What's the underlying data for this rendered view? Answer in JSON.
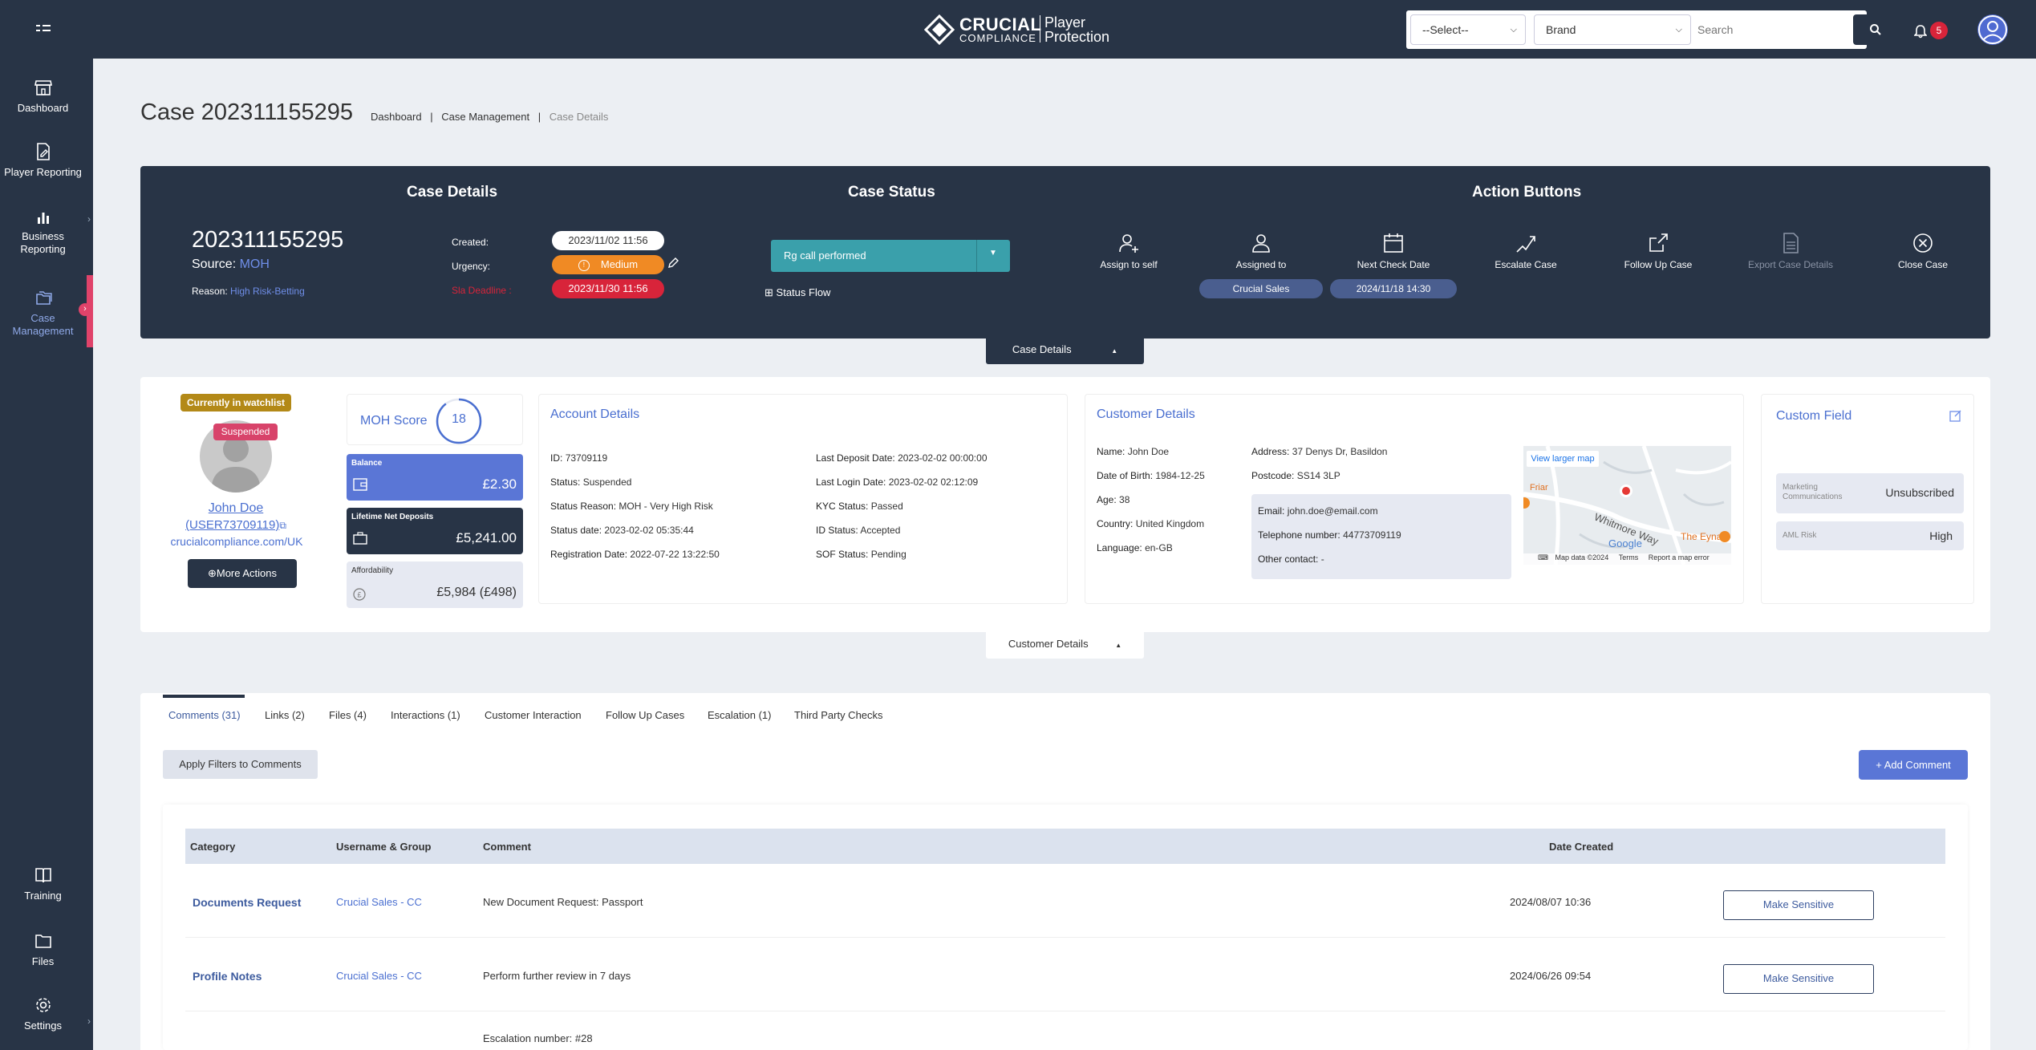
{
  "topbar": {
    "menu_icon": "grid-menu-icon",
    "logo_main": "CRUCIAL",
    "logo_sub": "COMPLIANCE",
    "logo_player": "Player",
    "logo_protection": "Protection",
    "select_value": "--Select--",
    "brand_value": "Brand",
    "search_placeholder": "Search",
    "notification_count": "5"
  },
  "sidebar": {
    "items": [
      {
        "label": "Dashboard",
        "icon": "store-icon"
      },
      {
        "label": "Player Reporting",
        "icon": "document-edit-icon"
      },
      {
        "label_1": "Business",
        "label_2": "Reporting",
        "icon": "bar-chart-icon"
      },
      {
        "label_1": "Case",
        "label_2": "Management",
        "icon": "folders-icon"
      },
      {
        "label": "Training",
        "icon": "book-icon"
      },
      {
        "label": "Files",
        "icon": "folder-icon"
      },
      {
        "label": "Settings",
        "icon": "gear-icon"
      }
    ]
  },
  "page": {
    "title": "Case 202311155295",
    "breadcrumb": [
      "Dashboard",
      "Case Management",
      "Case Details"
    ]
  },
  "case_panel": {
    "details_heading": "Case Details",
    "status_heading": "Case Status",
    "actions_heading": "Action Buttons",
    "case_number": "202311155295",
    "source_label": "Source:",
    "source_value": "MOH",
    "reason_label": "Reason:",
    "reason_value": "High Risk-Betting",
    "created_label": "Created:",
    "created_value": "2023/11/02 11:56",
    "urgency_label": "Urgency:",
    "urgency_value": "Medium",
    "sla_label": "Sla Deadline :",
    "sla_value": "2023/11/30 11:56",
    "status_value": "Rg call performed",
    "status_flow": "Status Flow",
    "actions": [
      {
        "label": "Assign to self",
        "icon": "user-add-icon"
      },
      {
        "label": "Assigned to",
        "icon": "user-icon",
        "badge": "Crucial Sales"
      },
      {
        "label": "Next Check Date",
        "icon": "calendar-icon",
        "badge": "2024/11/18 14:30"
      },
      {
        "label": "Escalate Case",
        "icon": "escalate-icon"
      },
      {
        "label": "Follow Up Case",
        "icon": "share-icon"
      },
      {
        "label": "Export Case Details",
        "icon": "export-document-icon"
      },
      {
        "label": "Close Case",
        "icon": "close-circle-icon"
      }
    ],
    "toggle_label": "Case Details"
  },
  "customer": {
    "watchlist_badge": "Currently in watchlist",
    "suspended_badge": "Suspended",
    "name": "John Doe",
    "user_id": "(USER73709119)",
    "site": "crucialcompliance.com/UK",
    "more_actions": "More Actions",
    "moh_score_label": "MOH Score",
    "moh_score": "18",
    "balance_label": "Balance",
    "balance_value": "£2.30",
    "lnd_label": "Lifetime Net Deposits",
    "lnd_value": "£5,241.00",
    "affordability_label": "Affordability",
    "affordability_value": "£5,984 (£498)"
  },
  "account_details": {
    "heading": "Account Details",
    "left": [
      {
        "k": "ID:",
        "v": "73709119"
      },
      {
        "k": "Status:",
        "v": "Suspended"
      },
      {
        "k": "Status Reason:",
        "v": "MOH - Very High Risk"
      },
      {
        "k": "Status date:",
        "v": "2023-02-02 05:35:44"
      },
      {
        "k": "Registration Date:",
        "v": "2022-07-22 13:22:50"
      }
    ],
    "right": [
      {
        "k": "Last Deposit Date:",
        "v": "2023-02-02 00:00:00"
      },
      {
        "k": "Last Login Date:",
        "v": "2023-02-02 02:12:09"
      },
      {
        "k": "KYC Status:",
        "v": "Passed"
      },
      {
        "k": "ID Status:",
        "v": "Accepted"
      },
      {
        "k": "SOF Status:",
        "v": "Pending"
      }
    ]
  },
  "customer_details": {
    "heading": "Customer Details",
    "left": [
      {
        "k": "Name:",
        "v": "John Doe"
      },
      {
        "k": "Date of Birth:",
        "v": "1984-12-25"
      },
      {
        "k": "Age:",
        "v": "38"
      },
      {
        "k": "Country:",
        "v": "United Kingdom"
      },
      {
        "k": "Language:",
        "v": "en-GB"
      }
    ],
    "address_k": "Address:",
    "address_v": "37 Denys Dr, Basildon",
    "postcode_k": "Postcode:",
    "postcode_v": "SS14 3LP",
    "email_k": "Email:",
    "email_v": "john.doe@email.com",
    "phone_k": "Telephone number:",
    "phone_v": "44773709119",
    "other_k": "Other contact:",
    "other_v": "-",
    "map_link": "View larger map",
    "map_labels": [
      "Friar",
      "Whitmore Way",
      "The Eyna",
      "Google"
    ],
    "map_footer": [
      "Map data ©2024",
      "Terms",
      "Report a map error"
    ]
  },
  "custom_field": {
    "heading": "Custom Field",
    "items": [
      {
        "k": "Marketing Communications",
        "v": "Unsubscribed"
      },
      {
        "k": "AML Risk",
        "v": "High"
      }
    ]
  },
  "customer_toggle": "Customer Details",
  "tabs": [
    "Comments (31)",
    "Links (2)",
    "Files (4)",
    "Interactions (1)",
    "Customer Interaction",
    "Follow Up Cases",
    "Escalation (1)",
    "Third Party Checks"
  ],
  "comments": {
    "filter_button": "Apply Filters to Comments",
    "add_button": "+ Add Comment",
    "headers": [
      "Category",
      "Username & Group",
      "Comment",
      "Date Created"
    ],
    "rows": [
      {
        "category": "Documents Request",
        "user": "Crucial Sales - CC",
        "comment": "New Document Request: Passport",
        "date": "2024/08/07 10:36",
        "action": "Make Sensitive"
      },
      {
        "category": "Profile Notes",
        "user": "Crucial Sales - CC",
        "comment": "Perform further review in 7 days",
        "date": "2024/06/26 09:54",
        "action": "Make Sensitive"
      },
      {
        "comment": "Escalation number: #28"
      }
    ]
  },
  "colors": {
    "navy": "#283446",
    "accent_blue": "#5a76d6",
    "teal": "#3aa0ab",
    "orange": "#f08a24",
    "red": "#d8243a"
  }
}
